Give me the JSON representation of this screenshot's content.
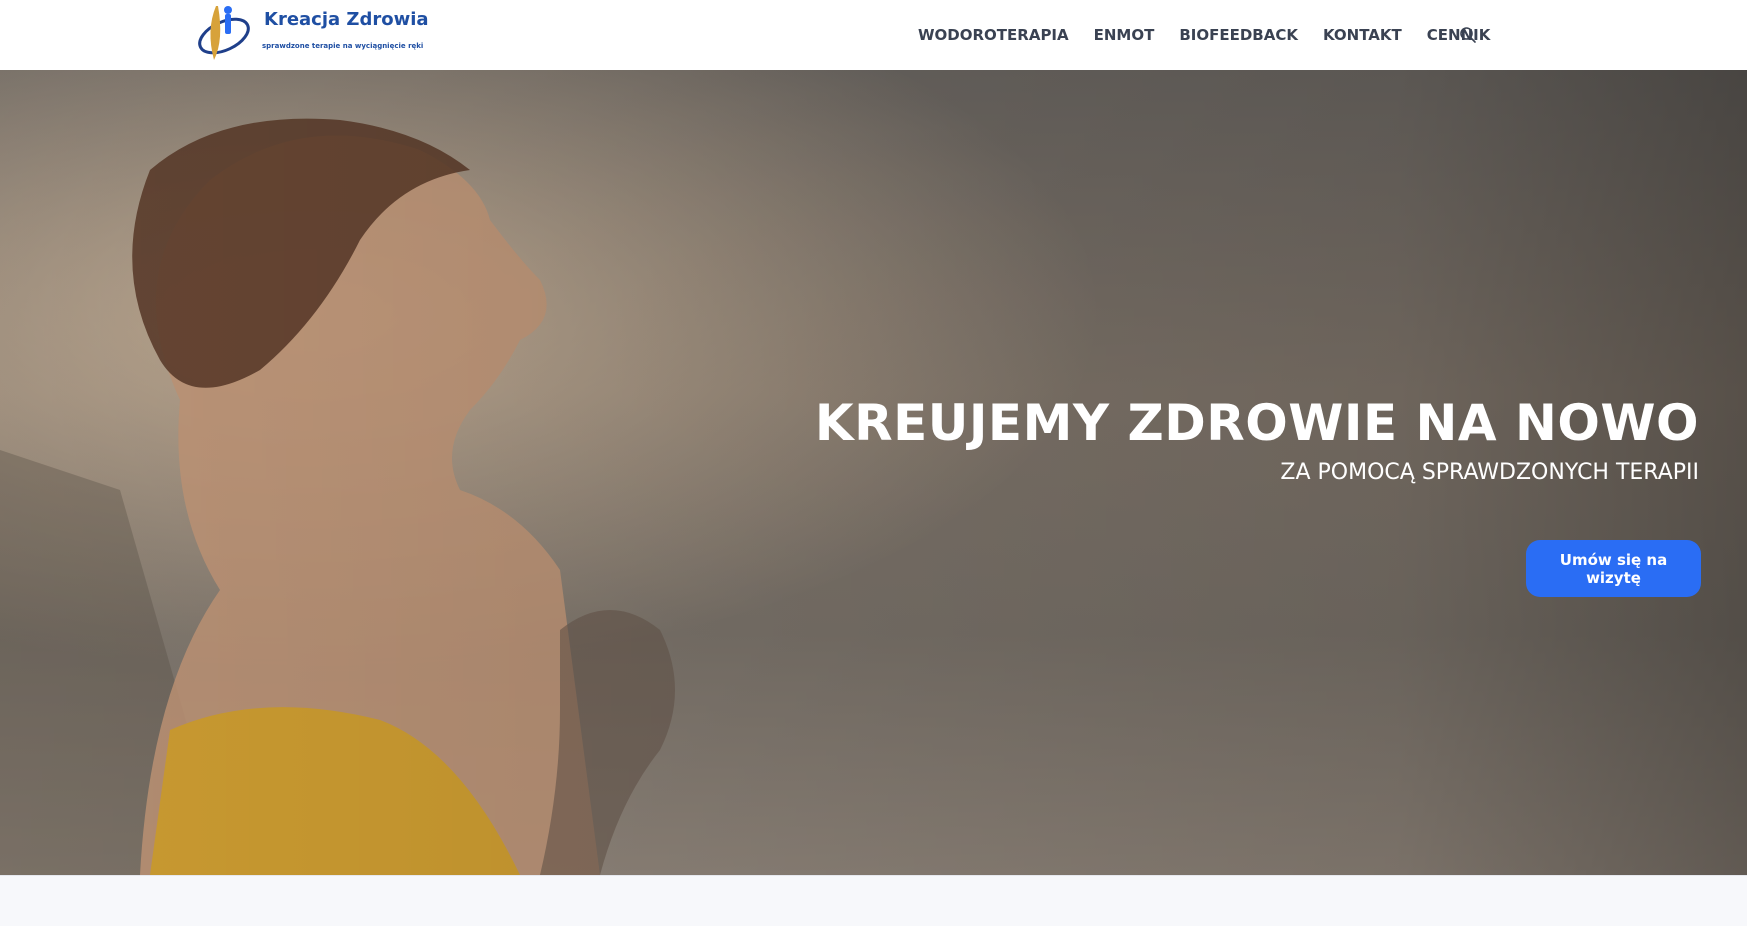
{
  "header": {
    "logo_title": "Kreacja Zdrowia",
    "logo_tagline": "sprawdzone terapie na wyciągnięcie ręki",
    "nav": [
      "WODOROTERAPIA",
      "ENMOT",
      "BIOFEEDBACK",
      "KONTAKT",
      "CENNIK"
    ],
    "search_icon": "search-icon"
  },
  "hero": {
    "title": "KREUJEMY ZDROWIE NA NOWO",
    "subtitle": "ZA POMOCĄ SPRAWDZONYCH TERAPII",
    "cta_label": "Umów się na wizytę"
  },
  "colors": {
    "brand_blue": "#1f4fa3",
    "cta_blue": "#2a6df4",
    "nav_text": "#3a4252"
  }
}
